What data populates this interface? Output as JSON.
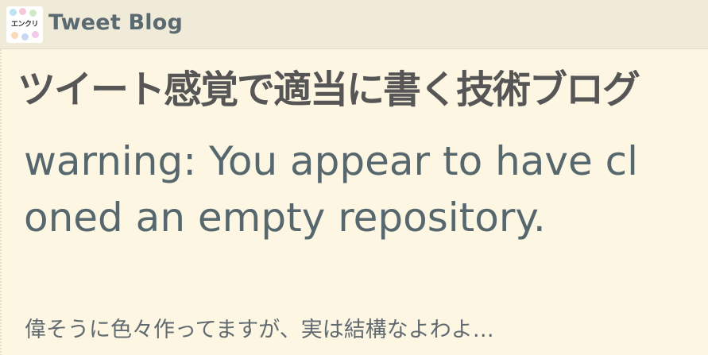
{
  "header": {
    "logo_text": "エンクリ",
    "site_title": "Tweet Blog"
  },
  "banner": {
    "text": "ツイート感覚で適当に書く技術ブログ"
  },
  "post": {
    "title": "warning: You appear to have cloned an empty repository.",
    "excerpt": "偉そうに色々作ってますが、実は結構なよわよ…"
  },
  "colors": {
    "background": "#fdf6e2",
    "header_bg": "#f0ead8",
    "title_text": "#56676e",
    "banner_text": "#565656"
  }
}
